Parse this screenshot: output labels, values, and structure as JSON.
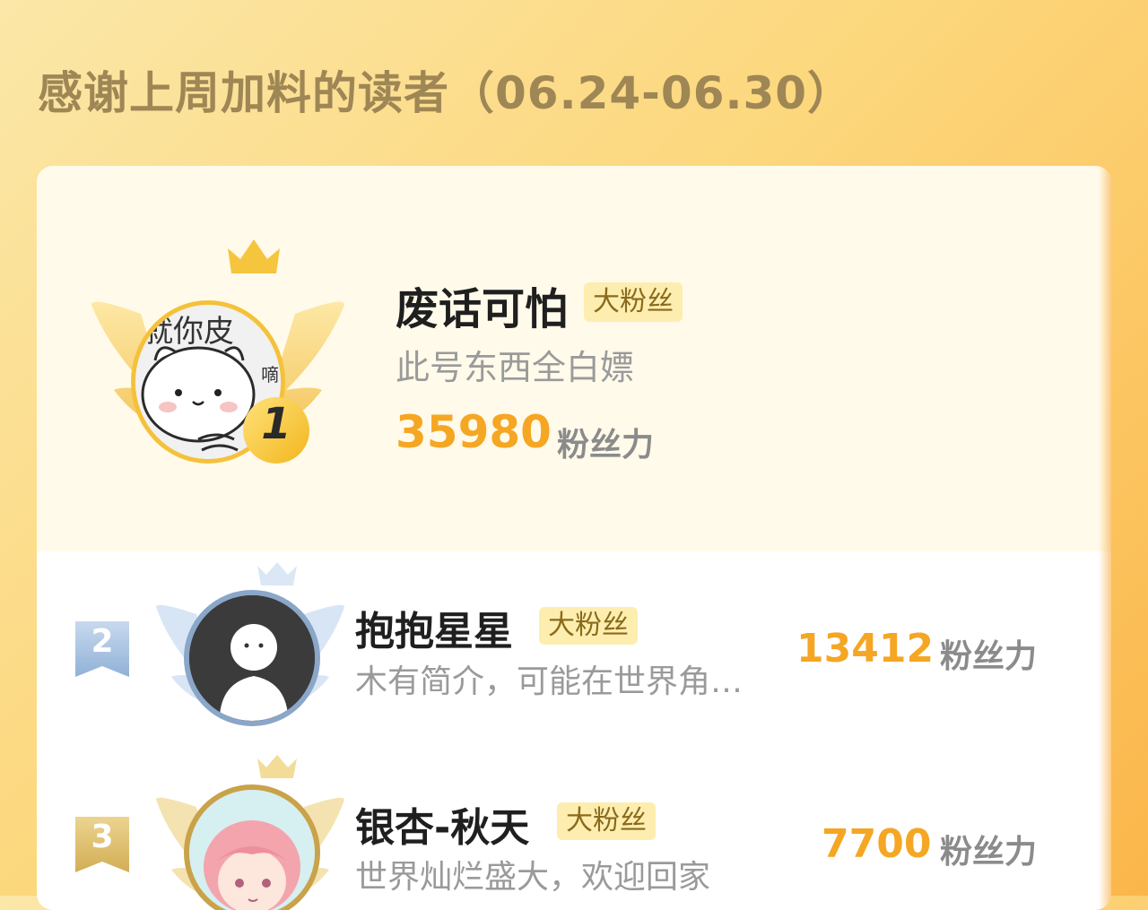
{
  "heading": "感谢上周加料的读者（06.24-06.30）",
  "entries": [
    {
      "rank": "1",
      "name": "废话可怕",
      "badge": "大粉丝",
      "bio": "此号东西全白嫖",
      "power": "35980",
      "unit": "粉丝力",
      "avatar_text": "就你皮",
      "avatar_side_text": "嘀"
    },
    {
      "rank": "2",
      "name": "抱抱星星",
      "badge": "大粉丝",
      "bio": "木有简介，可能在世界角…",
      "power": "13412",
      "unit": "粉丝力"
    },
    {
      "rank": "3",
      "name": "银杏-秋天",
      "badge": "大粉丝",
      "bio": "世界灿烂盛大，欢迎回家",
      "power": "7700",
      "unit": "粉丝力"
    }
  ],
  "colors": {
    "accent": "#f5a623",
    "gold": "#f7c23a",
    "silver_blue": "#8fb3da",
    "bronze": "#d9b25a"
  },
  "icons": {
    "crown": "crown-icon",
    "wings": "wings-icon",
    "rank_flag": "rank-flag-icon"
  }
}
